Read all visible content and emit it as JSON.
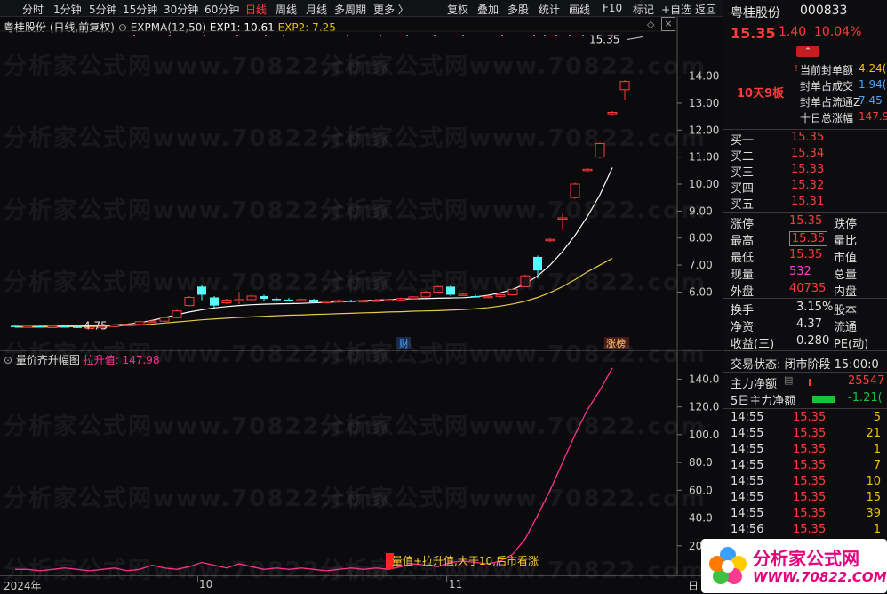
{
  "toolbar": {
    "periods": [
      "分时",
      "1分钟",
      "5分钟",
      "15分钟",
      "30分钟",
      "60分钟",
      "日线",
      "周线",
      "月线",
      "多周期",
      "更多 〉"
    ],
    "active_period": "日线",
    "tools": [
      "复权",
      "叠加",
      "多股",
      "统计",
      "画线",
      "F10",
      "标记",
      "+自选",
      "返回"
    ]
  },
  "main_chart": {
    "legend_name": "粤桂股份 (日线,前复权)",
    "indicator": "EXPMA(12,50)",
    "exp1_label": "EXP1: 10.61",
    "exp2_label": "EXP2: 7.25",
    "high_label": "15.35",
    "low_label": "4.75",
    "marker_cai": "财",
    "marker_zb": "涨榜"
  },
  "sub_chart": {
    "legend_name": "量价齐升幅图",
    "value_label": "拉升值: 147.98",
    "annotation": "量值+拉升值,大于10,后市看涨"
  },
  "x_axis": {
    "labels": [
      "2024年",
      "10",
      "11"
    ],
    "corner": "日"
  },
  "chart_data": [
    {
      "type": "line",
      "title": "粤桂股份 (日线,前复权)",
      "y_ticks": [
        6.0,
        7.0,
        8.0,
        9.0,
        10.0,
        11.0,
        12.0,
        13.0,
        14.0
      ],
      "ylim": [
        4.4,
        15.6
      ],
      "series": [
        {
          "name": "EXP1",
          "color": "#ffffff",
          "values": [
            4.72,
            4.72,
            4.73,
            4.73,
            4.74,
            4.74,
            4.75,
            4.76,
            4.78,
            4.81,
            4.86,
            4.95,
            5.05,
            5.16,
            5.26,
            5.34,
            5.41,
            5.46,
            5.5,
            5.53,
            5.55,
            5.56,
            5.57,
            5.58,
            5.6,
            5.62,
            5.64,
            5.66,
            5.68,
            5.7,
            5.72,
            5.74,
            5.75,
            5.76,
            5.77,
            5.78,
            5.79,
            5.82,
            5.88,
            5.97,
            6.1,
            6.3,
            6.6,
            7.0,
            7.5,
            8.1,
            8.8,
            9.6,
            10.61
          ]
        },
        {
          "name": "EXP2",
          "color": "#e8c84a",
          "values": [
            4.7,
            4.7,
            4.7,
            4.71,
            4.71,
            4.72,
            4.72,
            4.73,
            4.74,
            4.76,
            4.78,
            4.81,
            4.85,
            4.89,
            4.93,
            4.97,
            5.0,
            5.03,
            5.06,
            5.08,
            5.1,
            5.12,
            5.14,
            5.15,
            5.17,
            5.18,
            5.2,
            5.21,
            5.23,
            5.24,
            5.26,
            5.27,
            5.29,
            5.3,
            5.31,
            5.33,
            5.35,
            5.38,
            5.42,
            5.48,
            5.56,
            5.66,
            5.8,
            5.98,
            6.2,
            6.46,
            6.75,
            7.0,
            7.25
          ]
        }
      ],
      "candles": [
        {
          "o": 4.75,
          "c": 4.72,
          "h": 4.78,
          "l": 4.69
        },
        {
          "o": 4.72,
          "c": 4.74,
          "h": 4.76,
          "l": 4.7
        },
        {
          "o": 4.74,
          "c": 4.71,
          "h": 4.76,
          "l": 4.7
        },
        {
          "o": 4.71,
          "c": 4.73,
          "h": 4.75,
          "l": 4.69
        },
        {
          "o": 4.73,
          "c": 4.72,
          "h": 4.75,
          "l": 4.71
        },
        {
          "o": 4.72,
          "c": 4.68,
          "h": 4.74,
          "l": 4.66
        },
        {
          "o": 4.68,
          "c": 4.7,
          "h": 4.72,
          "l": 4.66
        },
        {
          "o": 4.7,
          "c": 4.72,
          "h": 4.74,
          "l": 4.68
        },
        {
          "o": 4.72,
          "c": 4.78,
          "h": 4.8,
          "l": 4.71
        },
        {
          "o": 4.78,
          "c": 4.8,
          "h": 4.82,
          "l": 4.76
        },
        {
          "o": 4.8,
          "c": 4.9,
          "h": 4.92,
          "l": 4.79
        },
        {
          "o": 4.9,
          "c": 4.92,
          "h": 4.98,
          "l": 4.88
        },
        {
          "o": 4.92,
          "c": 5.05,
          "h": 5.08,
          "l": 4.9
        },
        {
          "o": 5.05,
          "c": 5.3,
          "h": 5.34,
          "l": 5.03
        },
        {
          "o": 5.5,
          "c": 5.8,
          "h": 5.85,
          "l": 5.48
        },
        {
          "o": 6.2,
          "c": 5.9,
          "h": 6.25,
          "l": 5.7
        },
        {
          "o": 5.8,
          "c": 5.5,
          "h": 5.85,
          "l": 5.4
        },
        {
          "o": 5.6,
          "c": 5.7,
          "h": 5.75,
          "l": 5.55
        },
        {
          "o": 5.7,
          "c": 5.72,
          "h": 6.0,
          "l": 5.55
        },
        {
          "o": 5.72,
          "c": 5.85,
          "h": 5.9,
          "l": 5.68
        },
        {
          "o": 5.85,
          "c": 5.75,
          "h": 5.9,
          "l": 5.65
        },
        {
          "o": 5.75,
          "c": 5.72,
          "h": 5.8,
          "l": 5.68
        },
        {
          "o": 5.72,
          "c": 5.7,
          "h": 5.78,
          "l": 5.66
        },
        {
          "o": 5.7,
          "c": 5.72,
          "h": 5.76,
          "l": 5.66
        },
        {
          "o": 5.72,
          "c": 5.62,
          "h": 5.75,
          "l": 5.58
        },
        {
          "o": 5.62,
          "c": 5.65,
          "h": 5.7,
          "l": 5.58
        },
        {
          "o": 5.65,
          "c": 5.68,
          "h": 5.72,
          "l": 5.6
        },
        {
          "o": 5.68,
          "c": 5.66,
          "h": 5.72,
          "l": 5.62
        },
        {
          "o": 5.66,
          "c": 5.68,
          "h": 5.72,
          "l": 5.62
        },
        {
          "o": 5.68,
          "c": 5.7,
          "h": 5.74,
          "l": 5.64
        },
        {
          "o": 5.7,
          "c": 5.72,
          "h": 5.76,
          "l": 5.66
        },
        {
          "o": 5.72,
          "c": 5.76,
          "h": 5.8,
          "l": 5.68
        },
        {
          "o": 5.76,
          "c": 5.82,
          "h": 5.85,
          "l": 5.72
        },
        {
          "o": 5.82,
          "c": 6.0,
          "h": 6.05,
          "l": 5.8
        },
        {
          "o": 6.0,
          "c": 6.2,
          "h": 6.25,
          "l": 5.98
        },
        {
          "o": 6.2,
          "c": 5.9,
          "h": 6.25,
          "l": 5.85
        },
        {
          "o": 5.9,
          "c": 5.92,
          "h": 5.96,
          "l": 5.86
        },
        {
          "o": 5.85,
          "c": 5.82,
          "h": 5.9,
          "l": 5.78
        },
        {
          "o": 5.82,
          "c": 5.84,
          "h": 5.88,
          "l": 5.78
        },
        {
          "o": 5.84,
          "c": 5.9,
          "h": 5.94,
          "l": 5.8
        },
        {
          "o": 5.9,
          "c": 6.1,
          "h": 6.15,
          "l": 5.88
        },
        {
          "o": 6.2,
          "c": 6.6,
          "h": 6.65,
          "l": 6.18
        },
        {
          "o": 7.3,
          "c": 6.8,
          "h": 7.35,
          "l": 6.5
        },
        {
          "o": 7.9,
          "c": 7.95,
          "h": 8.0,
          "l": 7.85
        },
        {
          "o": 8.7,
          "c": 8.75,
          "h": 8.9,
          "l": 8.3
        },
        {
          "o": 9.5,
          "c": 10.0,
          "h": 10.05,
          "l": 9.45
        },
        {
          "o": 10.5,
          "c": 10.55,
          "h": 10.6,
          "l": 10.45
        },
        {
          "o": 11.0,
          "c": 11.5,
          "h": 11.55,
          "l": 10.95
        },
        {
          "o": 12.6,
          "c": 12.65,
          "h": 12.7,
          "l": 12.55
        },
        {
          "o": 13.5,
          "c": 13.8,
          "h": 13.85,
          "l": 13.1
        }
      ]
    },
    {
      "type": "line",
      "title": "量价齐升幅图",
      "y_ticks": [
        20.0,
        40.0,
        60.0,
        80.0,
        100.0,
        120.0,
        140.0
      ],
      "ylim": [
        0,
        155
      ],
      "series": [
        {
          "name": "拉升值",
          "color": "#ff2f8f",
          "values": [
            3,
            3,
            2,
            3,
            4,
            3,
            2,
            3,
            4,
            2,
            3,
            6,
            4,
            3,
            5,
            8,
            6,
            4,
            7,
            5,
            3,
            4,
            3,
            4,
            3,
            2,
            3,
            4,
            3,
            4,
            3,
            5,
            7,
            6,
            5,
            8,
            9,
            8,
            7,
            9,
            14,
            25,
            42,
            60,
            80,
            100,
            118,
            132,
            147.98
          ]
        }
      ]
    }
  ],
  "right_panel": {
    "stock_name": "粤桂股份",
    "stock_code": "000833",
    "price": "15.35",
    "change": "1.40",
    "change_pct": "10.04%",
    "tag": "10天9板",
    "seal_items": [
      {
        "label": "当前封单额",
        "value": "4.24("
      },
      {
        "label": "封单占成交",
        "value": "1.94("
      },
      {
        "label": "封单占流通Z",
        "value": "7.45"
      },
      {
        "label": "十日总涨幅",
        "value": "147.9"
      }
    ],
    "bids": [
      {
        "label": "买一",
        "price": "15.35"
      },
      {
        "label": "买二",
        "price": "15.34"
      },
      {
        "label": "买三",
        "price": "15.33"
      },
      {
        "label": "买四",
        "price": "15.32"
      },
      {
        "label": "买五",
        "price": "15.31"
      }
    ],
    "stats_left": [
      {
        "label": "涨停",
        "value": "15.35",
        "color": "red"
      },
      {
        "label": "最高",
        "value": "15.35",
        "color": "red"
      },
      {
        "label": "最低",
        "value": "15.35",
        "color": "red"
      },
      {
        "label": "现量",
        "value": "532",
        "color": "magenta"
      },
      {
        "label": "外盘",
        "value": "40735",
        "color": "red"
      }
    ],
    "stats_right": [
      "跌停",
      "量比",
      "市值",
      "总量",
      "内盘"
    ],
    "fin": [
      {
        "label": "换手",
        "value": "3.15%",
        "r": "股本"
      },
      {
        "label": "净资",
        "value": "4.37",
        "r": "流通"
      },
      {
        "label": "收益(三)",
        "value": "0.280",
        "r": "PE(动)"
      }
    ],
    "trade_status": "交易状态: 闭市阶段 15:00:0",
    "main_net": {
      "label": "主力净额",
      "value": "25547"
    },
    "main_net5": {
      "label": "5日主力净额",
      "value": "-1.21("
    },
    "ticks": [
      {
        "t": "14:55",
        "p": "15.35",
        "v": "5"
      },
      {
        "t": "14:55",
        "p": "15.35",
        "v": "21"
      },
      {
        "t": "14:55",
        "p": "15.35",
        "v": "1"
      },
      {
        "t": "14:55",
        "p": "15.35",
        "v": "7"
      },
      {
        "t": "14:55",
        "p": "15.35",
        "v": "10"
      },
      {
        "t": "14:55",
        "p": "15.35",
        "v": "15"
      },
      {
        "t": "14:55",
        "p": "15.35",
        "v": "39"
      },
      {
        "t": "14:56",
        "p": "15.35",
        "v": "1"
      }
    ]
  },
  "watermark": "分析家公式网www.70822.com",
  "logo": {
    "title": "分析家公式网",
    "url": "WWW.70822.COM"
  }
}
